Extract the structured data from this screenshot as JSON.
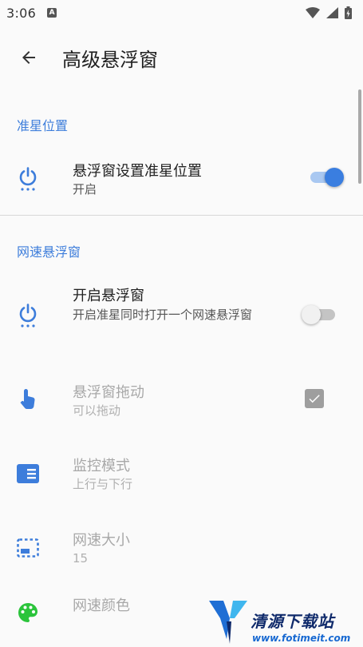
{
  "status_bar": {
    "time": "3:06",
    "notification_letter": "A"
  },
  "app_bar": {
    "title": "高级悬浮窗",
    "back_icon": "arrow-back-icon"
  },
  "sections": [
    {
      "header": "准星位置",
      "items": [
        {
          "title": "悬浮窗设置准星位置",
          "summary": "开启",
          "icon": "power-icon",
          "control": "switch",
          "checked": true,
          "enabled": true
        }
      ]
    },
    {
      "header": "网速悬浮窗",
      "items": [
        {
          "title": "开启悬浮窗",
          "summary": "开启准星同时打开一个网速悬浮窗",
          "icon": "power-icon",
          "control": "switch",
          "checked": false,
          "enabled": true
        },
        {
          "title": "悬浮窗拖动",
          "summary": "可以拖动",
          "icon": "touch-icon",
          "control": "checkbox",
          "checked": true,
          "enabled": false
        },
        {
          "title": "监控模式",
          "summary": "上行与下行",
          "icon": "list-icon",
          "enabled": false
        },
        {
          "title": "网速大小",
          "summary": "15",
          "icon": "dashed-box-icon",
          "enabled": false
        },
        {
          "title": "网速颜色",
          "summary": "",
          "icon": "palette-icon",
          "enabled": false
        }
      ]
    }
  ],
  "watermark": {
    "title": "清源下载站",
    "url": "www.fotimeit.com"
  },
  "colors": {
    "accent": "#3a7ee0",
    "accent_track": "#a9c8f1",
    "icon_blue": "#3d7ddb",
    "palette_green": "#2bc43b",
    "disabled_text": "#a8a8a8"
  }
}
